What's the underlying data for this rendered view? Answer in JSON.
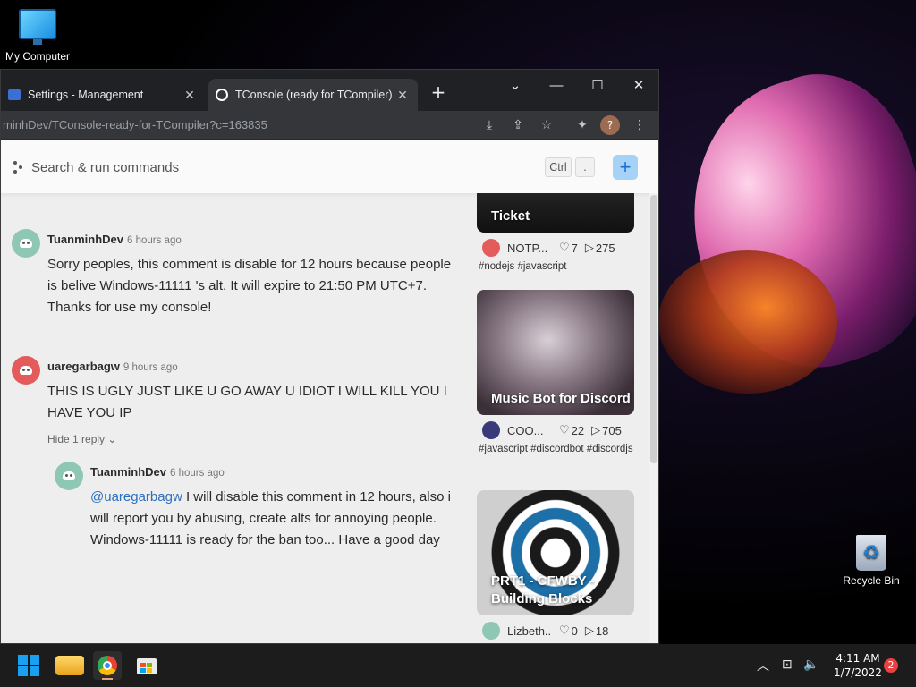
{
  "desktop": {
    "icons": [
      {
        "label": "My Computer"
      },
      {
        "label": "Recycle Bin"
      }
    ]
  },
  "browser": {
    "tabs": [
      {
        "title": "Settings - Management",
        "active": false
      },
      {
        "title": "TConsole (ready for TCompiler) - ",
        "active": true
      }
    ],
    "url": "minhDev/TConsole-ready-for-TCompiler?c=163835",
    "profile_initial": "?"
  },
  "page": {
    "search": {
      "placeholder": "Search & run commands",
      "shortcut_key1": "Ctrl",
      "shortcut_key2": "."
    },
    "add_button": "+",
    "comments": [
      {
        "author": "TuanminhDev",
        "time": "6 hours ago",
        "text": "Sorry peoples, this comment is disable for 12 hours because people is belive Windows-11111 's alt. It will expire to 21:50 PM UTC+7. Thanks for use my console!",
        "avatar_color": "#8fc7b5"
      },
      {
        "author": "uaregarbagw",
        "time": "9 hours ago",
        "text": "THIS IS UGLY JUST LIKE U GO AWAY U IDIOT I WILL KILL YOU I HAVE YOU IP",
        "avatar_color": "#e45b5b",
        "hide_replies": "Hide 1 reply"
      },
      {
        "author": "TuanminhDev",
        "time": "6 hours ago",
        "mention": "@uaregarbagw",
        "text": " I will disable this comment in 12 hours, also i will report you by abusing, create alts for annoying people. Windows-11111 is ready for the ban too... Have a good day",
        "avatar_color": "#8fc7b5"
      }
    ],
    "cards": [
      {
        "title": "Ticket",
        "owner": "NOTP...",
        "likes": "7",
        "runs": "275",
        "tags": "#nodejs #javascript"
      },
      {
        "title": "Music Bot for Discord",
        "owner": "COO...",
        "likes": "22",
        "runs": "705",
        "tags": "#javascript #discordbot #discordjs"
      },
      {
        "title": "PRT1 - CFWBY - Building Blocks",
        "owner": "Lizbeth...",
        "likes": "0",
        "runs": "18",
        "tags": ""
      }
    ]
  },
  "taskbar": {
    "time": "4:11 AM",
    "date": "1/7/2022",
    "notifications": "2"
  },
  "colors": {
    "accent": "#1a6fd1",
    "mention": "#2d6fbd"
  }
}
